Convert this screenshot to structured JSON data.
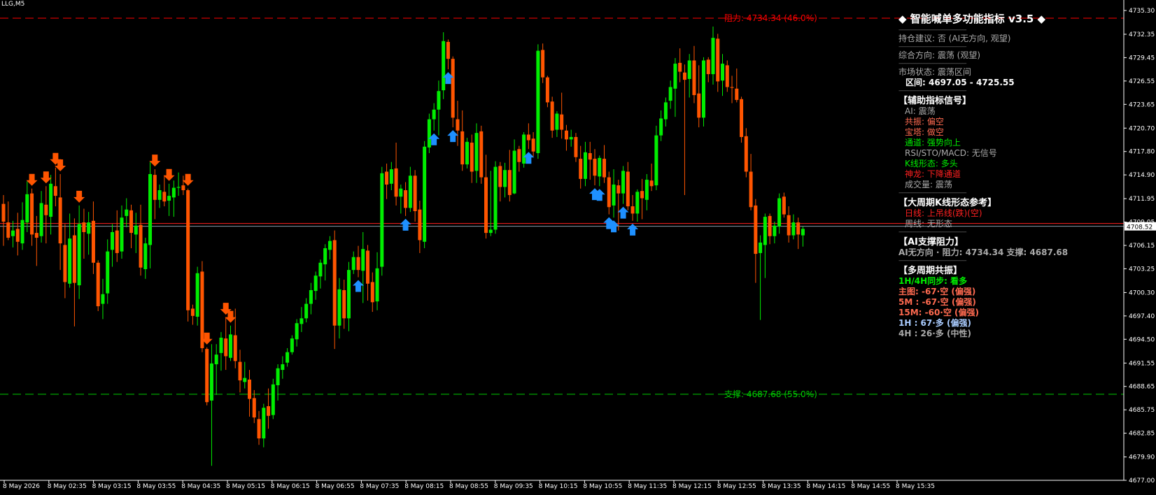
{
  "window": {
    "symbol": "LLG,M5"
  },
  "price_axis": {
    "ticks": [
      "4735.30",
      "4732.35",
      "4729.45",
      "4726.55",
      "4723.65",
      "4720.70",
      "4717.80",
      "4714.90",
      "4711.95",
      "4709.05",
      "4706.15",
      "4703.25",
      "4700.30",
      "4697.40",
      "4694.50",
      "4691.55",
      "4688.65",
      "4685.75",
      "4682.85",
      "4679.90",
      "4677.00"
    ],
    "current_price": "4708.52"
  },
  "time_axis": {
    "ticks": [
      "8 May 2026",
      "8 May 02:35",
      "8 May 03:15",
      "8 May 03:55",
      "8 May 04:35",
      "8 May 05:15",
      "8 May 06:15",
      "8 May 06:55",
      "8 May 07:35",
      "8 May 08:15",
      "8 May 08:55",
      "8 May 09:35",
      "8 May 10:15",
      "8 May 10:55",
      "8 May 11:35",
      "8 May 12:15",
      "8 May 12:55",
      "8 May 13:35",
      "8 May 14:15",
      "8 May 14:55",
      "8 May 15:35"
    ]
  },
  "levels": {
    "resistance": {
      "label": "阻力: 4734.34 (46.0%)",
      "price": 4734.34,
      "color": "#ff0000"
    },
    "support": {
      "label": "支撑: 4687.68 (55.0%)",
      "price": 4687.68,
      "color": "#00cc00"
    }
  },
  "colors": {
    "bull": "#00ee00",
    "bear": "#ff5500",
    "buy_arrow": "#1e90ff",
    "sell_arrow": "#ff5500"
  },
  "panel": {
    "title": "◆ 智能喊单多功能指标 v3.5 ◆",
    "separator": "-------------------------------------------",
    "position_advice": "持仓建议: 否 (AI无方向, 观望)",
    "overall_direction": "综合方向: 震荡 (观望)",
    "market_state": "市场状态: 震荡区间",
    "range": "区间: 4697.05 - 4725.55",
    "aux_header": "【辅助指标信号】",
    "aux": [
      {
        "text": "AI: 震荡",
        "color": "#aaaaaa"
      },
      {
        "text": "共振: 偏空",
        "color": "#ff6a50"
      },
      {
        "text": "宝塔: 做空",
        "color": "#ff6a50"
      },
      {
        "text": "通道: 强势向上",
        "color": "#00ee00"
      },
      {
        "text": "RSI/STO/MACD: 无信号",
        "color": "#aaaaaa"
      },
      {
        "text": "K线形态: 多头",
        "color": "#00ee00"
      },
      {
        "text": "神龙: 下降通道",
        "color": "#ff2020"
      },
      {
        "text": "成交量: 震荡",
        "color": "#aaaaaa"
      }
    ],
    "big_header": "【大周期K线形态参考】",
    "big": [
      {
        "text": "日线: 上吊线(跌)(空)",
        "color": "#ff2020"
      },
      {
        "text": "周线: 无形态",
        "color": "#aaaaaa"
      }
    ],
    "sr_header": "【AI支撑阻力】",
    "sr_line": "AI无方向 · 阻力: 4734.34   支撑: 4687.68",
    "multi_header": "【多周期共振】",
    "multi": [
      {
        "text": "1H/4H同步: 看多",
        "color": "#00ee00"
      },
      {
        "text": "主图: -67·空 (偏强)",
        "color": "#ff6a50"
      },
      {
        "text": "5M : -67·空 (偏强)",
        "color": "#ff6a50"
      },
      {
        "text": "15M: -60·空 (偏强)",
        "color": "#ff6a50"
      },
      {
        "text": "1H : 67·多 (偏强)",
        "color": "#aaccff"
      },
      {
        "text": "4H : 26·多 (中性)",
        "color": "#aaaaaa"
      }
    ]
  },
  "chart_data": {
    "type": "candlestick",
    "timeframe": "M5",
    "ylim": [
      4677.0,
      4737.0
    ],
    "candles": [
      [
        4711.3,
        4712.4,
        4706.1,
        4709.1
      ],
      [
        4709.0,
        4711.6,
        4706.8,
        4707.1
      ],
      [
        4707.3,
        4709.2,
        4705.9,
        4708.0
      ],
      [
        4708.2,
        4710.2,
        4704.9,
        4706.6
      ],
      [
        4706.4,
        4711.5,
        4705.6,
        4709.3
      ],
      [
        4709.0,
        4714.1,
        4707.8,
        4712.5
      ],
      [
        4712.6,
        4713.2,
        4706.1,
        4707.5
      ],
      [
        4707.7,
        4709.8,
        4703.6,
        4707.1
      ],
      [
        4707.3,
        4712.9,
        4706.5,
        4711.4
      ],
      [
        4711.2,
        4713.5,
        4706.4,
        4709.9
      ],
      [
        4709.7,
        4714.9,
        4707.5,
        4713.8
      ],
      [
        4713.5,
        4715.8,
        4711.0,
        4712.3
      ],
      [
        4712.1,
        4715.0,
        4703.1,
        4706.4
      ],
      [
        4706.2,
        4708.8,
        4699.6,
        4701.6
      ],
      [
        4701.4,
        4710.1,
        4700.9,
        4707.0
      ],
      [
        4707.4,
        4709.5,
        4696.1,
        4701.5
      ],
      [
        4701.2,
        4711.1,
        4699.5,
        4708.8
      ],
      [
        4709.0,
        4710.7,
        4704.5,
        4707.8
      ],
      [
        4707.6,
        4710.3,
        4705.0,
        4709.0
      ],
      [
        4709.2,
        4711.6,
        4702.6,
        4704.0
      ],
      [
        4704.0,
        4704.3,
        4698.0,
        4698.6
      ],
      [
        4698.9,
        4702.0,
        4697.0,
        4700.1
      ],
      [
        4700.2,
        4706.9,
        4698.9,
        4705.4
      ],
      [
        4705.6,
        4708.8,
        4703.5,
        4707.8
      ],
      [
        4708.0,
        4710.5,
        4704.1,
        4705.2
      ],
      [
        4705.4,
        4711.1,
        4704.5,
        4709.6
      ],
      [
        4709.8,
        4712.0,
        4708.4,
        4710.6
      ],
      [
        4710.5,
        4711.2,
        4705.8,
        4707.7
      ],
      [
        4707.5,
        4710.2,
        4705.2,
        4708.6
      ],
      [
        4708.7,
        4711.2,
        4702.4,
        4703.4
      ],
      [
        4703.2,
        4707.1,
        4702.0,
        4706.4
      ],
      [
        4706.2,
        4716.5,
        4703.3,
        4715.0
      ],
      [
        4714.9,
        4715.6,
        4709.4,
        4711.8
      ],
      [
        4711.8,
        4713.7,
        4710.8,
        4713.0
      ],
      [
        4712.8,
        4714.8,
        4711.0,
        4711.6
      ],
      [
        4711.7,
        4713.8,
        4709.8,
        4712.3
      ],
      [
        4712.1,
        4714.2,
        4709.7,
        4713.3
      ],
      [
        4713.3,
        4715.2,
        4712.3,
        4713.4
      ],
      [
        4713.6,
        4714.8,
        4712.4,
        4713.0
      ],
      [
        4713.0,
        4713.2,
        4696.7,
        4698.1
      ],
      [
        4698.3,
        4698.8,
        4696.3,
        4697.4
      ],
      [
        4697.3,
        4703.5,
        4696.2,
        4702.7
      ],
      [
        4702.9,
        4704.2,
        4692.9,
        4693.4
      ],
      [
        4693.3,
        4693.5,
        4686.3,
        4686.7
      ],
      [
        4686.9,
        4693.9,
        4678.8,
        4691.5
      ],
      [
        4691.4,
        4693.9,
        4687.6,
        4692.6
      ],
      [
        4692.8,
        4695.4,
        4690.6,
        4694.7
      ],
      [
        4694.6,
        4697.2,
        4690.7,
        4692.4
      ],
      [
        4692.2,
        4696.2,
        4691.8,
        4695.1
      ],
      [
        4695.0,
        4698.3,
        4690.9,
        4691.8
      ],
      [
        4691.7,
        4693.2,
        4687.9,
        4689.4
      ],
      [
        4689.2,
        4691.7,
        4688.4,
        4689.7
      ],
      [
        4689.5,
        4690.7,
        4684.9,
        4687.1
      ],
      [
        4687.2,
        4688.2,
        4684.1,
        4684.8
      ],
      [
        4684.6,
        4685.6,
        4681.4,
        4682.2
      ],
      [
        4682.2,
        4686.5,
        4681.1,
        4686.0
      ],
      [
        4686.2,
        4688.4,
        4683.4,
        4685.0
      ],
      [
        4685.1,
        4689.6,
        4684.6,
        4688.9
      ],
      [
        4688.8,
        4691.4,
        4686.9,
        4690.9
      ],
      [
        4690.7,
        4692.4,
        4689.6,
        4691.4
      ],
      [
        4691.6,
        4693.4,
        4691.1,
        4692.9
      ],
      [
        4692.9,
        4695.0,
        4692.6,
        4694.6
      ],
      [
        4694.5,
        4697.0,
        4693.6,
        4696.5
      ],
      [
        4696.4,
        4698.5,
        4695.4,
        4697.1
      ],
      [
        4697.1,
        4699.6,
        4696.6,
        4698.9
      ],
      [
        4698.9,
        4701.5,
        4697.6,
        4700.6
      ],
      [
        4700.5,
        4702.9,
        4699.4,
        4702.4
      ],
      [
        4702.3,
        4704.4,
        4700.8,
        4704.0
      ],
      [
        4703.8,
        4706.3,
        4701.8,
        4705.8
      ],
      [
        4705.6,
        4707.3,
        4704.4,
        4706.7
      ],
      [
        4706.8,
        4708.0,
        4693.3,
        4696.2
      ],
      [
        4696.2,
        4702.1,
        4694.6,
        4700.7
      ],
      [
        4700.6,
        4701.9,
        4695.8,
        4697.1
      ],
      [
        4697.1,
        4704.1,
        4695.5,
        4703.1
      ],
      [
        4703.1,
        4705.4,
        4702.6,
        4704.7
      ],
      [
        4704.7,
        4706.1,
        4702.2,
        4703.1
      ],
      [
        4703.0,
        4707.8,
        4699.0,
        4705.7
      ],
      [
        4705.5,
        4706.2,
        4699.3,
        4701.4
      ],
      [
        4701.6,
        4702.8,
        4697.9,
        4699.1
      ],
      [
        4699.2,
        4705.3,
        4698.1,
        4703.3
      ],
      [
        4703.5,
        4715.9,
        4702.4,
        4715.1
      ],
      [
        4715.3,
        4716.3,
        4711.9,
        4713.7
      ],
      [
        4713.8,
        4716.5,
        4713.0,
        4715.6
      ],
      [
        4715.7,
        4718.9,
        4711.1,
        4712.2
      ],
      [
        4712.2,
        4713.7,
        4710.1,
        4713.2
      ],
      [
        4713.0,
        4714.0,
        4709.8,
        4710.8
      ],
      [
        4710.8,
        4715.9,
        4710.3,
        4714.8
      ],
      [
        4714.8,
        4715.5,
        4709.1,
        4710.4
      ],
      [
        4710.6,
        4711.7,
        4705.2,
        4706.8
      ],
      [
        4706.6,
        4719.1,
        4705.8,
        4718.4
      ],
      [
        4718.3,
        4722.5,
        4717.6,
        4721.8
      ],
      [
        4721.8,
        4723.8,
        4720.4,
        4723.0
      ],
      [
        4723.0,
        4726.6,
        4719.8,
        4725.3
      ],
      [
        4725.4,
        4732.6,
        4724.3,
        4731.5
      ],
      [
        4731.4,
        4731.7,
        4728.0,
        4729.3
      ],
      [
        4729.3,
        4729.6,
        4720.8,
        4722.0
      ],
      [
        4721.8,
        4724.1,
        4718.5,
        4720.4
      ],
      [
        4720.3,
        4722.9,
        4715.4,
        4716.2
      ],
      [
        4716.2,
        4719.5,
        4715.7,
        4719.0
      ],
      [
        4718.9,
        4719.9,
        4713.9,
        4715.3
      ],
      [
        4715.4,
        4721.3,
        4713.9,
        4720.1
      ],
      [
        4720.3,
        4721.0,
        4713.8,
        4714.6
      ],
      [
        4714.6,
        4717.4,
        4707.0,
        4707.7
      ],
      [
        4707.7,
        4715.4,
        4707.3,
        4708.1
      ],
      [
        4708.1,
        4716.6,
        4707.6,
        4715.9
      ],
      [
        4716.0,
        4716.5,
        4711.6,
        4713.4
      ],
      [
        4713.4,
        4716.4,
        4712.1,
        4715.5
      ],
      [
        4715.5,
        4718.0,
        4711.6,
        4712.4
      ],
      [
        4712.6,
        4719.3,
        4712.5,
        4717.9
      ],
      [
        4718.1,
        4718.5,
        4715.3,
        4716.5
      ],
      [
        4716.3,
        4720.2,
        4715.8,
        4719.9
      ],
      [
        4719.9,
        4721.3,
        4718.1,
        4719.2
      ],
      [
        4719.4,
        4720.2,
        4717.2,
        4717.8
      ],
      [
        4717.6,
        4731.1,
        4716.9,
        4730.3
      ],
      [
        4730.4,
        4731.2,
        4726.3,
        4727.0
      ],
      [
        4727.0,
        4727.2,
        4723.3,
        4723.9
      ],
      [
        4724.0,
        4724.6,
        4719.5,
        4720.4
      ],
      [
        4720.5,
        4722.8,
        4719.6,
        4722.5
      ],
      [
        4722.4,
        4725.1,
        4719.4,
        4720.5
      ],
      [
        4720.4,
        4721.1,
        4717.9,
        4719.3
      ],
      [
        4719.3,
        4720.5,
        4718.4,
        4719.6
      ],
      [
        4719.6,
        4720.1,
        4716.5,
        4717.1
      ],
      [
        4716.9,
        4718.5,
        4713.2,
        4714.4
      ],
      [
        4714.4,
        4719.0,
        4713.5,
        4717.7
      ],
      [
        4717.6,
        4719.0,
        4714.3,
        4716.8
      ],
      [
        4716.9,
        4718.1,
        4713.6,
        4714.8
      ],
      [
        4714.7,
        4717.3,
        4713.5,
        4717.0
      ],
      [
        4716.9,
        4718.6,
        4713.9,
        4714.6
      ],
      [
        4714.6,
        4715.3,
        4710.0,
        4710.9
      ],
      [
        4711.1,
        4715.6,
        4709.6,
        4713.7
      ],
      [
        4713.6,
        4714.3,
        4708.0,
        4712.6
      ],
      [
        4712.6,
        4716.0,
        4711.3,
        4715.4
      ],
      [
        4715.3,
        4716.5,
        4710.5,
        4711.0
      ],
      [
        4711.0,
        4712.4,
        4709.2,
        4710.1
      ],
      [
        4710.1,
        4713.1,
        4709.1,
        4712.8
      ],
      [
        4712.9,
        4714.4,
        4709.4,
        4712.0
      ],
      [
        4711.8,
        4715.0,
        4710.5,
        4714.3
      ],
      [
        4714.2,
        4716.3,
        4712.9,
        4713.5
      ],
      [
        4713.6,
        4721.0,
        4713.0,
        4719.8
      ],
      [
        4719.8,
        4722.9,
        4719.1,
        4721.9
      ],
      [
        4721.8,
        4724.5,
        4720.9,
        4723.9
      ],
      [
        4724.1,
        4726.6,
        4723.1,
        4725.8
      ],
      [
        4725.6,
        4729.4,
        4722.1,
        4728.7
      ],
      [
        4728.8,
        4730.6,
        4726.4,
        4727.7
      ],
      [
        4727.6,
        4728.6,
        4712.4,
        4726.7
      ],
      [
        4726.8,
        4729.9,
        4724.5,
        4729.1
      ],
      [
        4729.1,
        4730.9,
        4723.8,
        4724.8
      ],
      [
        4725.0,
        4728.5,
        4720.8,
        4722.0
      ],
      [
        4722.0,
        4729.5,
        4720.9,
        4729.1
      ],
      [
        4729.2,
        4729.5,
        4726.4,
        4727.4
      ],
      [
        4727.4,
        4733.3,
        4726.1,
        4731.9
      ],
      [
        4731.8,
        4732.4,
        4725.2,
        4726.5
      ],
      [
        4726.6,
        4729.9,
        4724.7,
        4728.7
      ],
      [
        4728.5,
        4729.1,
        4725.2,
        4725.8
      ],
      [
        4725.8,
        4727.2,
        4723.8,
        4725.7
      ],
      [
        4725.6,
        4728.1,
        4723.9,
        4724.2
      ],
      [
        4724.3,
        4724.6,
        4718.9,
        4719.6
      ],
      [
        4719.7,
        4720.7,
        4714.6,
        4715.3
      ],
      [
        4715.3,
        4717.5,
        4710.5,
        4710.9
      ],
      [
        4711.1,
        4711.9,
        4701.5,
        4705.1
      ],
      [
        4705.2,
        4707.4,
        4696.9,
        4706.5
      ],
      [
        4706.2,
        4710.1,
        4702.1,
        4709.7
      ],
      [
        4709.8,
        4710.1,
        4706.3,
        4707.3
      ],
      [
        4707.3,
        4709.1,
        4706.4,
        4708.6
      ],
      [
        4708.5,
        4712.6,
        4707.6,
        4712.0
      ],
      [
        4712.2,
        4712.7,
        4709.6,
        4710.0
      ],
      [
        4709.9,
        4711.0,
        4706.5,
        4707.4
      ],
      [
        4707.4,
        4710.0,
        4706.9,
        4709.0
      ],
      [
        4709.0,
        4709.6,
        4705.7,
        4707.5
      ],
      [
        4707.4,
        4708.5,
        4706.0,
        4708.2
      ]
    ],
    "buy_signals": [
      75,
      85,
      91,
      94,
      95,
      111,
      125,
      126,
      128,
      129,
      131,
      133
    ],
    "sell_signals": [
      6,
      11,
      12,
      9,
      16,
      32,
      35,
      39,
      43,
      47,
      48
    ]
  }
}
